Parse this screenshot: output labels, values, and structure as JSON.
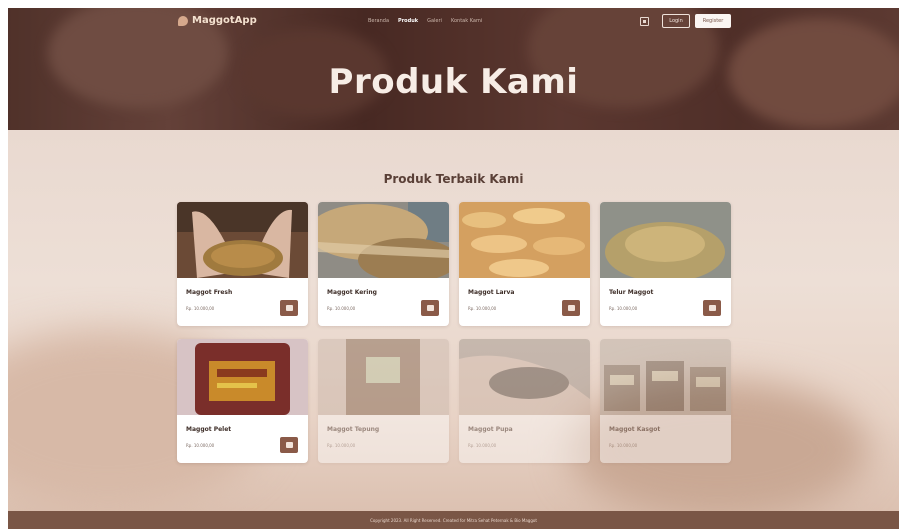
{
  "nav": {
    "brand": "MaggotApp",
    "menu": [
      {
        "label": "Beranda",
        "active": false
      },
      {
        "label": "Produk",
        "active": true
      },
      {
        "label": "Galeri",
        "active": false
      },
      {
        "label": "Kontak Kami",
        "active": false
      }
    ],
    "login_label": "Login",
    "register_label": "Register",
    "icons": {
      "brand": "leaf-logo-icon",
      "cart": "cart-icon"
    }
  },
  "hero": {
    "title": "Produk Kami"
  },
  "section": {
    "title": "Produk Terbaik Kami"
  },
  "products": [
    {
      "name": "Maggot Fresh",
      "price": "Rp. 10.000,00",
      "available": true
    },
    {
      "name": "Maggot Kering",
      "price": "Rp. 10.000,00",
      "available": true
    },
    {
      "name": "Maggot Larva",
      "price": "Rp. 10.000,00",
      "available": true
    },
    {
      "name": "Telur Maggot",
      "price": "Rp. 10.000,00",
      "available": true
    },
    {
      "name": "Maggot Pelet",
      "price": "Rp. 10.000,00",
      "available": true
    },
    {
      "name": "Maggot Tepung",
      "price": "Rp. 10.000,00",
      "available": false
    },
    {
      "name": "Maggot Pupa",
      "price": "Rp. 10.000,00",
      "available": false
    },
    {
      "name": "Maggot Kasgot",
      "price": "Rp. 10.000,00",
      "available": false
    }
  ],
  "footer": {
    "text": "Copyright 2023. All Right Reserved. Created for Mitra Sehat Peternak & Bio Maggot"
  },
  "colors": {
    "primary": "#8a5a48",
    "footer": "#7a5646",
    "hero": "#5b3d33"
  }
}
